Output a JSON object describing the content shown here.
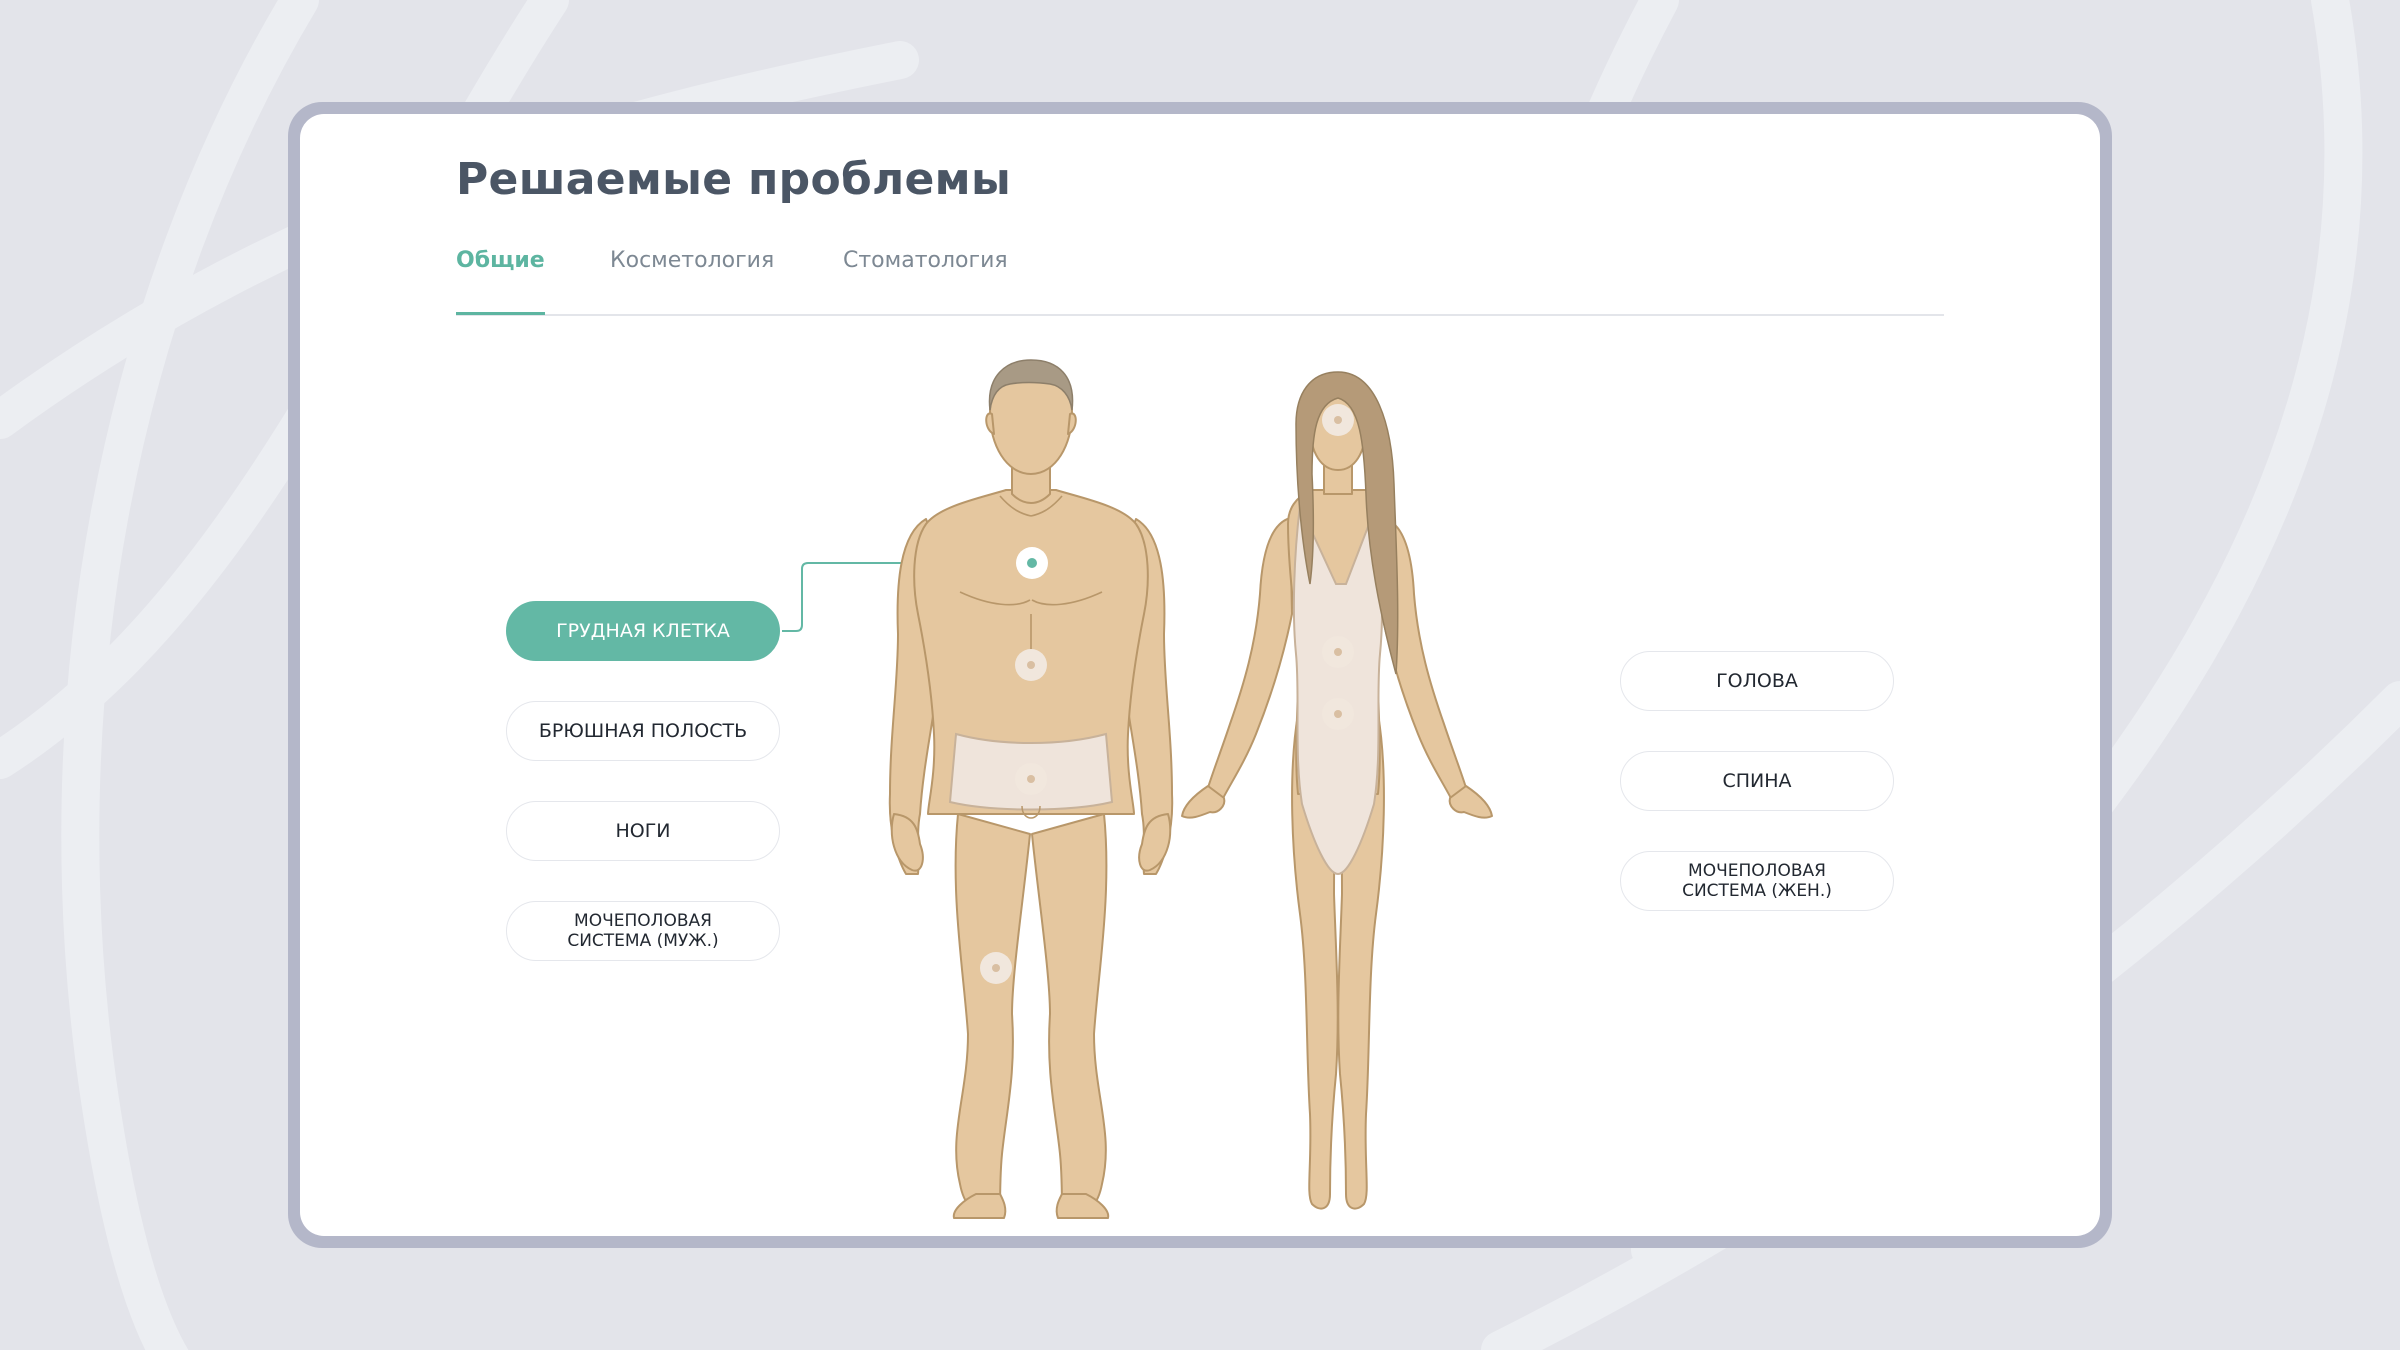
{
  "page": {
    "title": "Решаемые проблемы",
    "tabs": [
      {
        "label": "Общие",
        "active": true
      },
      {
        "label": "Косметология",
        "active": false
      },
      {
        "label": "Стоматология",
        "active": false
      }
    ]
  },
  "left_pills": [
    {
      "label": "ГРУДНАЯ КЛЕТКА",
      "active": true
    },
    {
      "label": "БРЮШНАЯ ПОЛОСТЬ",
      "active": false
    },
    {
      "label": "НОГИ",
      "active": false
    },
    {
      "label": "МОЧЕПОЛОВАЯ\nСИСТЕМА (МУЖ.)",
      "active": false
    }
  ],
  "right_pills": [
    {
      "label": "ГОЛОВА",
      "active": false
    },
    {
      "label": "СПИНА",
      "active": false
    },
    {
      "label": "МОЧЕПОЛОВАЯ\nСИСТЕМА (ЖЕН.)",
      "active": false
    }
  ],
  "colors": {
    "accent": "#63b8a5",
    "skin": "#e5c79f",
    "skin_outline": "#b8976a",
    "hair_male": "#a89a85",
    "hair_female": "#b59a78",
    "garment": "#efe4db",
    "background": "#e3e4ea",
    "frame": "#b4b7c9"
  }
}
